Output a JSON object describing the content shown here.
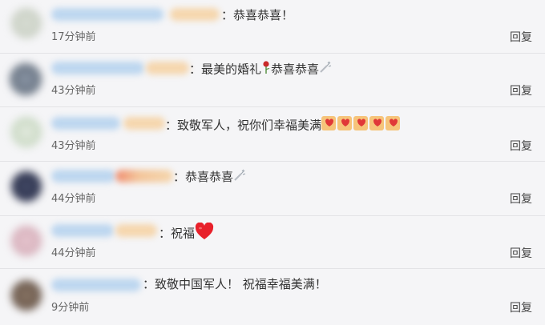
{
  "comments": [
    {
      "text": "：恭喜恭喜！",
      "time": "17分钟前",
      "reply_label": "回复"
    },
    {
      "text": "：最美的婚礼",
      "text2": "恭喜恭喜",
      "time": "43分钟前",
      "reply_label": "回复"
    },
    {
      "text": "：致敬军人，祝你们幸福美满",
      "time": "43分钟前",
      "reply_label": "回复"
    },
    {
      "text": "：恭喜恭喜",
      "time": "44分钟前",
      "reply_label": "回复"
    },
    {
      "text": "：祝福",
      "time": "44分钟前",
      "reply_label": "回复"
    },
    {
      "text": "：致敬中国军人！ 祝福幸福美满！",
      "time": "9分钟前",
      "reply_label": "回复"
    }
  ],
  "icons": {
    "rose": "rose-icon",
    "firecracker": "firecracker-icon",
    "hearts": "double-heart-icon",
    "heart": "red-heart-icon"
  },
  "colors": {
    "background": "#f5f5f7",
    "text": "#333333",
    "time": "#666666",
    "heart": "#e8202a"
  }
}
